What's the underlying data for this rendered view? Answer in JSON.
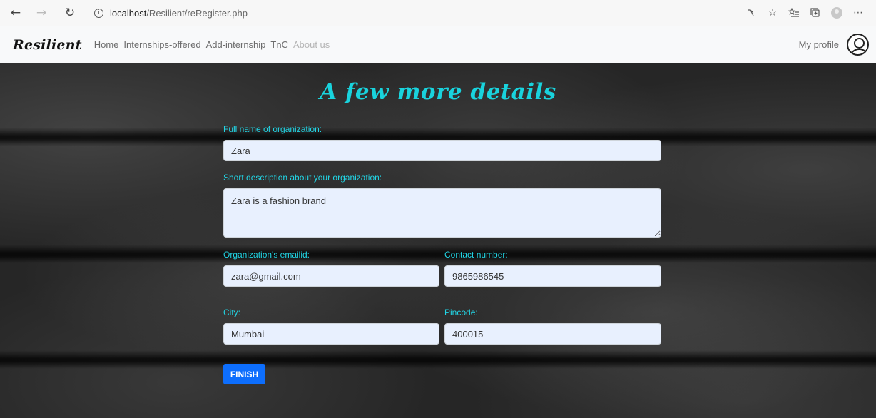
{
  "browser": {
    "url_host": "localhost",
    "url_path": "/Resilient/reRegister.php",
    "back_icon": "←",
    "forward_icon": "→",
    "reload_icon": "↻",
    "info_icon": "i"
  },
  "navbar": {
    "brand": "Resilient",
    "links": [
      "Home",
      "Internships-offered",
      "Add-internship",
      "TnC",
      "About us"
    ],
    "profile_label": "My profile"
  },
  "form": {
    "title": "A few more details",
    "org_name_label": "Full name of organization:",
    "org_name_value": "Zara",
    "description_label": "Short description about your organization:",
    "description_value": "Zara is a fashion brand",
    "email_label": "Organization's emailid:",
    "email_value": "zara@gmail.com",
    "contact_label": "Contact number:",
    "contact_value": "9865986545",
    "city_label": "City:",
    "city_value": "Mumbai",
    "pincode_label": "Pincode:",
    "pincode_value": "400015",
    "submit_label": "FINISH"
  },
  "colors": {
    "accent": "#19d3dd",
    "button": "#0d6efd",
    "input_bg": "#e8f0fe"
  }
}
